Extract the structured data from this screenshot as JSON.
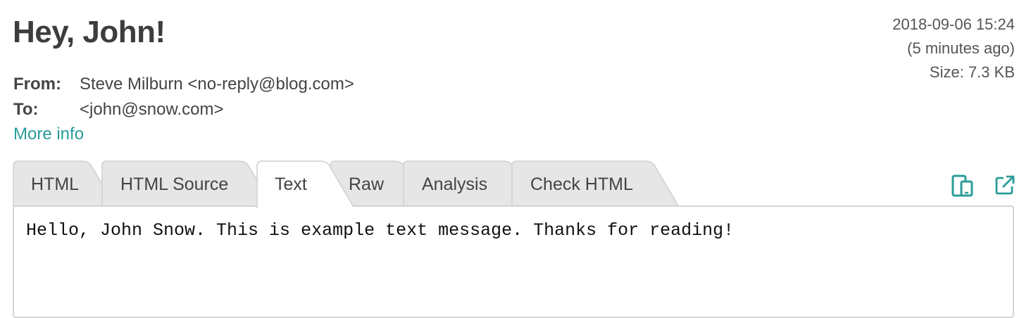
{
  "email": {
    "subject": "Hey, John!",
    "date": "2018-09-06 15:24",
    "relative_time": "(5 minutes ago)",
    "size": "Size: 7.3 KB",
    "from_label": "From:",
    "from_value": "Steve Milburn <no-reply@blog.com>",
    "to_label": "To:",
    "to_value": "<john@snow.com>",
    "more_info": "More info"
  },
  "tabs": [
    {
      "label": "HTML",
      "active": false
    },
    {
      "label": "HTML Source",
      "active": false
    },
    {
      "label": "Text",
      "active": true
    },
    {
      "label": "Raw",
      "active": false
    },
    {
      "label": "Analysis",
      "active": false
    },
    {
      "label": "Check HTML",
      "active": false
    }
  ],
  "content": {
    "text": "Hello, John Snow. This is example text message. Thanks for reading!"
  },
  "toolbar": {
    "icons": [
      "responsive-view-icon",
      "open-external-icon"
    ]
  },
  "colors": {
    "accent": "#2a9d99",
    "tab_inactive": "#e6e6e6",
    "tab_active": "#ffffff",
    "border": "#d4d4d4"
  }
}
